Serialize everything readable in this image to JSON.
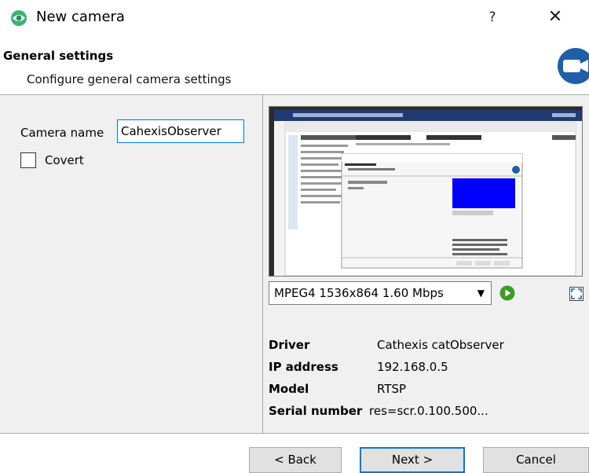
{
  "window": {
    "title": "New camera",
    "help_label": "?",
    "close_label": "✕"
  },
  "header": {
    "title": "General settings",
    "subtitle": "Configure general camera settings"
  },
  "form": {
    "camera_name_label": "Camera name",
    "camera_name_value": "CahexisObserver",
    "covert_label": "Covert",
    "covert_checked": false
  },
  "stream": {
    "selected": "MPEG4 1536x864 1.60 Mbps",
    "dropdown_arrow": "▼"
  },
  "info": {
    "driver_label": "Driver",
    "driver_value": "Cathexis catObserver",
    "ip_label": "IP address",
    "ip_value": "192.168.0.5",
    "model_label": "Model",
    "model_value": "RTSP",
    "serial_label": "Serial number",
    "serial_value": "res=scr.0.100.500..."
  },
  "buttons": {
    "back": "< Back",
    "next": "Next >",
    "cancel": "Cancel"
  },
  "colors": {
    "accent": "#0078d7",
    "app_icon": "#3cb371",
    "camera_badge": "#1e5fa8",
    "play": "#3a9d23",
    "preview_blue": "#0000ff"
  },
  "icons": {
    "app": "eye-icon",
    "badge": "camera-icon",
    "play": "play-icon",
    "fullscreen": "fullscreen-icon"
  }
}
